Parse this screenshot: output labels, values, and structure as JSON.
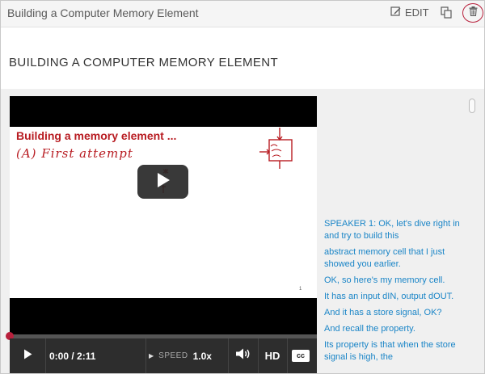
{
  "header": {
    "title": "Building a Computer Memory Element",
    "edit_label": "EDIT"
  },
  "page": {
    "heading": "BUILDING A COMPUTER MEMORY ELEMENT"
  },
  "video": {
    "slide_title": "Building a memory element ...",
    "slide_subtitle": "(A) First attempt",
    "slide_number": "1",
    "time": "0:00 / 2:11",
    "speed_label": "SPEED",
    "speed_value": "1.0x",
    "hd_label": "HD",
    "cc_label": "cc",
    "progress_fraction": 0
  },
  "transcript": [
    "SPEAKER 1: OK, let's dive right in and try to build this",
    "abstract memory cell that I just showed you earlier.",
    "OK, so here's my memory cell.",
    "It has an input dIN, output dOUT.",
    "And it has a store signal, OK?",
    "And recall the property.",
    "Its property is that when the store signal is high, the"
  ],
  "colors": {
    "accent": "#b8203c",
    "transcript_text": "#1a85c7",
    "slide_ink": "#b81c22"
  }
}
